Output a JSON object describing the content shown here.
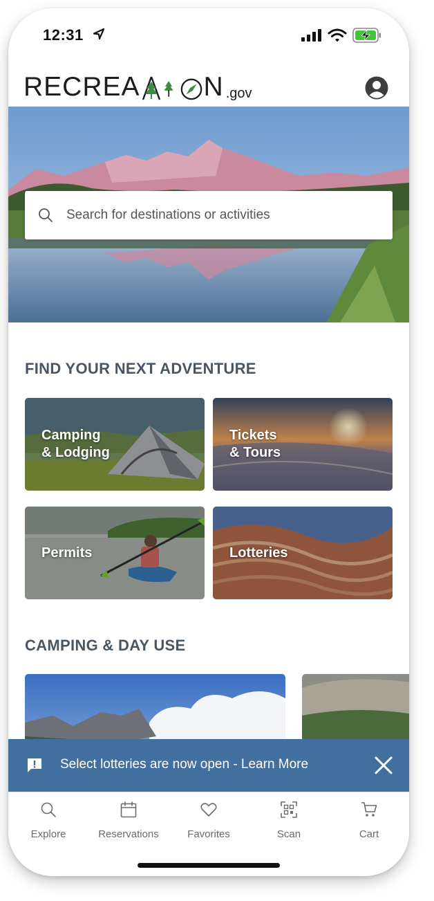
{
  "status_bar": {
    "time": "12:31"
  },
  "header": {
    "logo_left": "RECREA",
    "logo_mid": "I",
    "logo_right": "N",
    "logo_suffix": ".gov",
    "profile_icon": "user-circle-icon"
  },
  "search": {
    "placeholder": "Search for destinations or activities"
  },
  "adventure": {
    "heading": "FIND YOUR NEXT ADVENTURE",
    "tiles": [
      {
        "label": "Camping\n& Lodging"
      },
      {
        "label": "Tickets\n& Tours"
      },
      {
        "label": "Permits"
      },
      {
        "label": "Lotteries"
      }
    ]
  },
  "camping": {
    "heading": "CAMPING & DAY USE"
  },
  "banner": {
    "text": "Select lotteries are now open - Learn More"
  },
  "tabs": [
    {
      "label": "Explore",
      "icon": "search-icon"
    },
    {
      "label": "Reservations",
      "icon": "calendar-icon"
    },
    {
      "label": "Favorites",
      "icon": "heart-icon"
    },
    {
      "label": "Scan",
      "icon": "qr-scan-icon"
    },
    {
      "label": "Cart",
      "icon": "cart-icon"
    }
  ],
  "colors": {
    "banner": "#41709f",
    "heading": "#4a5563"
  }
}
